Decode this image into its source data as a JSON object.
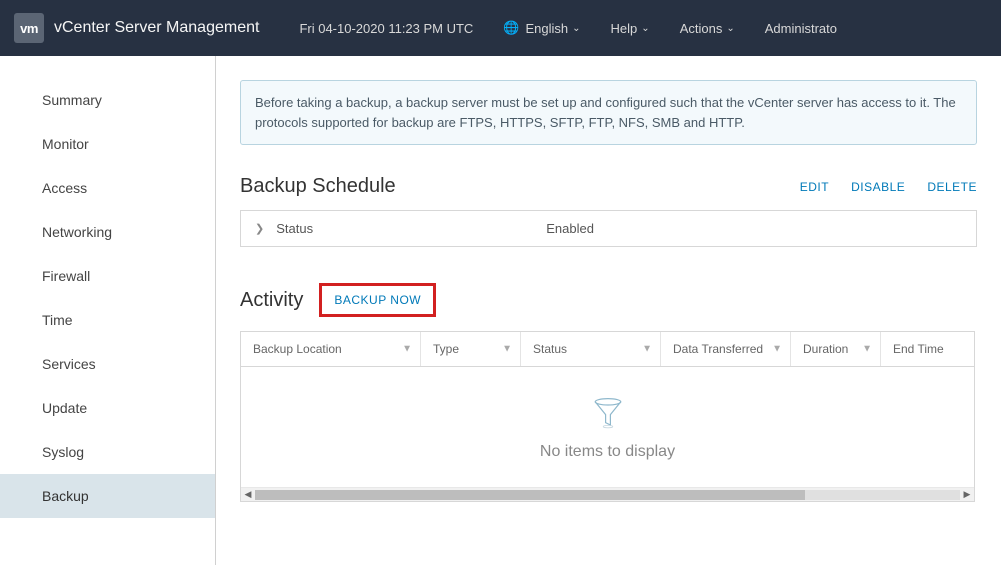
{
  "topbar": {
    "logo": "vm",
    "title": "vCenter Server Management",
    "datetime": "Fri 04-10-2020 11:23 PM UTC",
    "language": "English",
    "help": "Help",
    "actions": "Actions",
    "user": "Administrato"
  },
  "sidebar": {
    "items": [
      {
        "label": "Summary"
      },
      {
        "label": "Monitor"
      },
      {
        "label": "Access"
      },
      {
        "label": "Networking"
      },
      {
        "label": "Firewall"
      },
      {
        "label": "Time"
      },
      {
        "label": "Services"
      },
      {
        "label": "Update"
      },
      {
        "label": "Syslog"
      },
      {
        "label": "Backup"
      }
    ],
    "active_index": 9
  },
  "info_message": "Before taking a backup, a backup server must be set up and configured such that the vCenter server has access to it. The protocols supported for backup are FTPS, HTTPS, SFTP, FTP, NFS, SMB and HTTP.",
  "backup_schedule": {
    "title": "Backup Schedule",
    "edit": "EDIT",
    "disable": "DISABLE",
    "delete": "DELETE",
    "status_label": "Status",
    "status_value": "Enabled"
  },
  "activity": {
    "title": "Activity",
    "backup_now": "BACKUP NOW",
    "columns": {
      "location": "Backup Location",
      "type": "Type",
      "status": "Status",
      "data": "Data Transferred",
      "duration": "Duration",
      "end": "End Time"
    },
    "empty": "No items to display"
  }
}
